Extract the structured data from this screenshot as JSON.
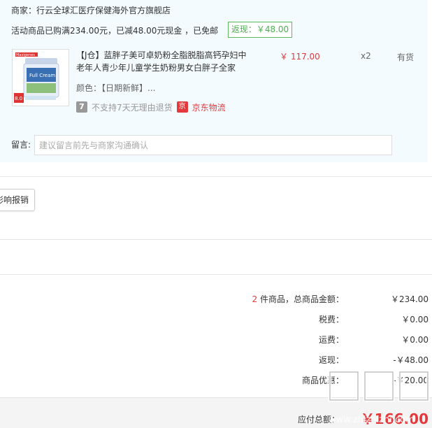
{
  "merchant": {
    "label": "商家：行云全球汇医疗保健海外官方旗舰店"
  },
  "promo": {
    "text": "活动商品已购满234.00元，已减48.00元现金 ，已免邮"
  },
  "cashback": {
    "label": "返现：￥48.00"
  },
  "product": {
    "title": "【J仓】蓝胖子美可卓奶粉全脂脱脂高钙孕妇中老年人青少年儿童学生奶粉男女白胖子全家",
    "price": "￥ 117.00",
    "qty": "x2",
    "stock": "有货",
    "color": "颜色：【日期新鲜】...",
    "no_return_icon": "7",
    "no_return": "不支持7天无理由退货",
    "jd_icon": "京",
    "jd_logistics": "京东物流",
    "image_brand": "Maxigenes",
    "image_product": "Full Cream",
    "image_badge": "8.0"
  },
  "message": {
    "label": "留言:",
    "placeholder": "建议留言前先与商家沟通确认"
  },
  "report_button": {
    "label": "影响报销"
  },
  "summary": {
    "count": "2",
    "items_label": " 件商品，总商品金额：",
    "items_value": "￥234.00",
    "tax_label": "税费：",
    "tax_value": "￥0.00",
    "shipping_label": "运费：",
    "shipping_value": "￥0.00",
    "cashback_label": "返现：",
    "cashback_value": "-￥48.00",
    "discount_label": "商品优惠：",
    "discount_value": "-￥20.00"
  },
  "total": {
    "label": "应付总额：",
    "value": "￥166.00"
  },
  "watermark": {
    "logo": "值",
    "text": "www.zhizhizhi.com"
  },
  "colors": {
    "accent_red": "#e4393c",
    "green": "#4caf50",
    "block_bg": "#f3fbfe"
  }
}
